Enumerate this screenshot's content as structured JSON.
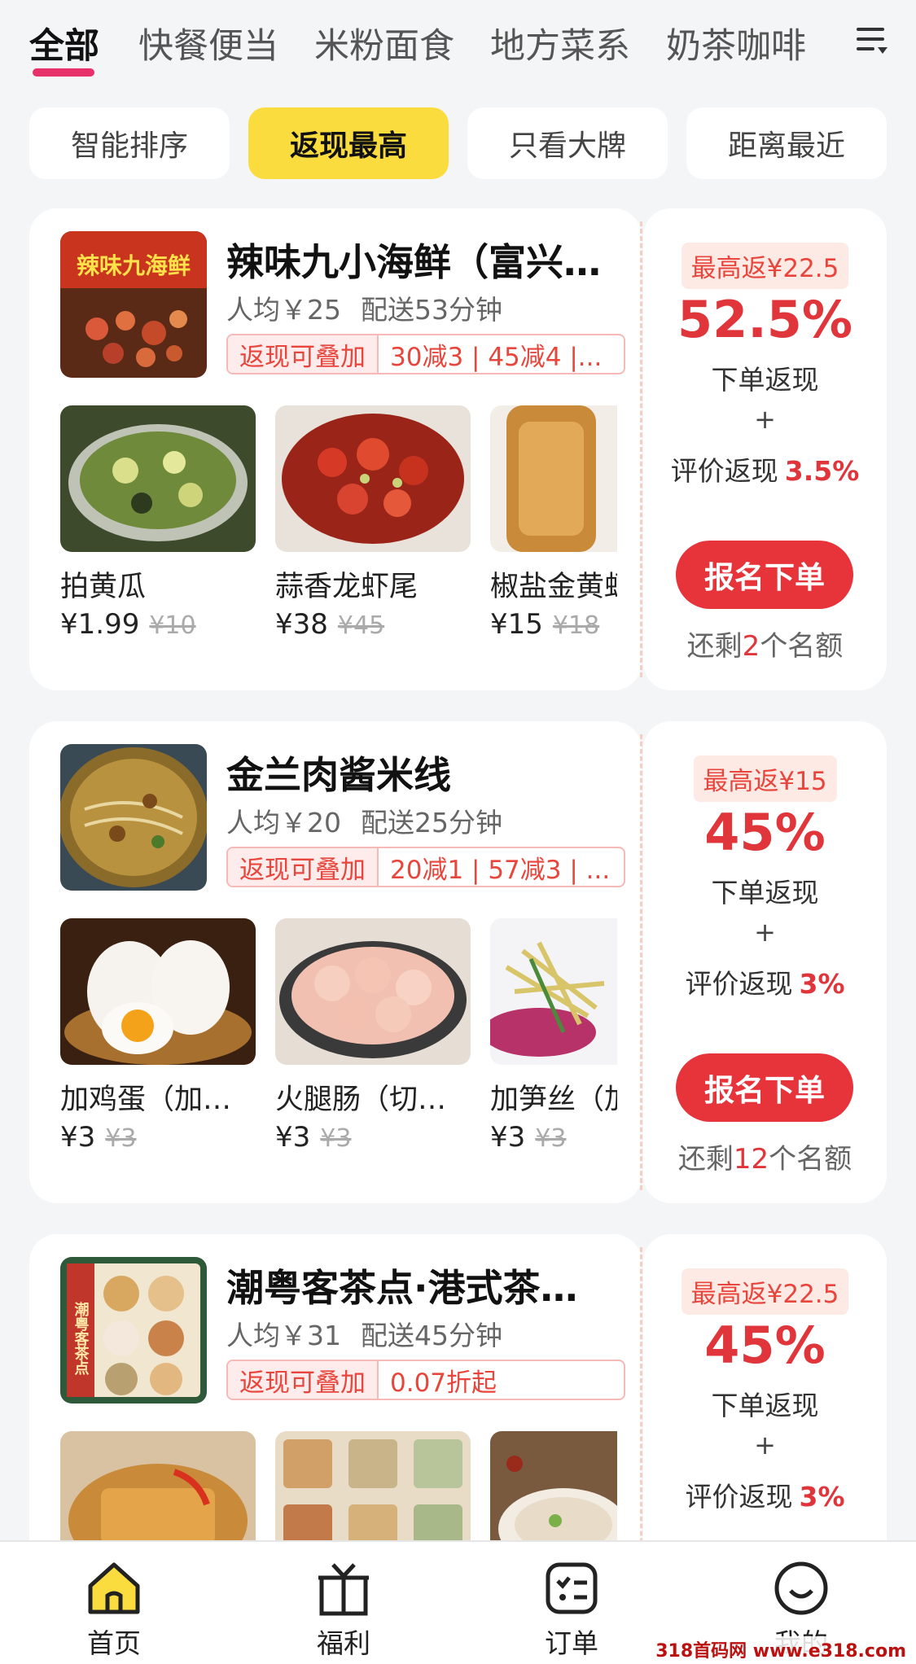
{
  "category_tabs": [
    {
      "label": "全部"
    },
    {
      "label": "快餐便当"
    },
    {
      "label": "米粉面食"
    },
    {
      "label": "地方菜系"
    },
    {
      "label": "奶茶咖啡"
    }
  ],
  "active_tab_index": 0,
  "menu_icon": "menu-icon",
  "sort_chips": [
    {
      "label": "智能排序"
    },
    {
      "label": "返现最高"
    },
    {
      "label": "只看大牌"
    },
    {
      "label": "距离最近"
    }
  ],
  "active_sort_index": 1,
  "colors": {
    "accent_red": "#e0363b",
    "active_chip": "#fbdc3f",
    "tab_underline": "#e8306a"
  },
  "stores": [
    {
      "name": "辣味九小海鲜（富兴…",
      "logo_text": "辣味九海鲜",
      "avg_price": "人均￥25",
      "delivery": "配送53分钟",
      "promo_tag": "返现可叠加",
      "promo_text": "30减3 | 45减4 |...",
      "dishes": [
        {
          "name": "拍黄瓜",
          "price": "¥1.99",
          "orig": "¥10"
        },
        {
          "name": "蒜香龙虾尾",
          "price": "¥38",
          "orig": "¥45"
        },
        {
          "name": "椒盐金黄虾",
          "price": "¥15",
          "orig": "¥18"
        }
      ],
      "max_return": "最高返¥22.5",
      "rate": "52.5%",
      "rate_label": "下单返现",
      "plus": "+",
      "review_label": "评价返现",
      "review_rate": "3.5%",
      "button": "报名下单",
      "quota_prefix": "还剩",
      "quota_count": "2",
      "quota_suffix": "个名额"
    },
    {
      "name": "金兰肉酱米线",
      "logo_text": "",
      "avg_price": "人均￥20",
      "delivery": "配送25分钟",
      "promo_tag": "返现可叠加",
      "promo_text": "20减1 | 57减3 | ...",
      "dishes": [
        {
          "name": "加鸡蛋（加…",
          "price": "¥3",
          "orig": "¥3"
        },
        {
          "name": "火腿肠（切…",
          "price": "¥3",
          "orig": "¥3"
        },
        {
          "name": "加笋丝（加",
          "price": "¥3",
          "orig": "¥3"
        }
      ],
      "max_return": "最高返¥15",
      "rate": "45%",
      "rate_label": "下单返现",
      "plus": "+",
      "review_label": "评价返现",
      "review_rate": "3%",
      "button": "报名下单",
      "quota_prefix": "还剩",
      "quota_count": "12",
      "quota_suffix": "个名额"
    },
    {
      "name": "潮粤客茶点·港式茶…",
      "logo_text": "潮粤客茶点",
      "avg_price": "人均￥31",
      "delivery": "配送45分钟",
      "promo_tag": "返现可叠加",
      "promo_text": "0.07折起",
      "dishes": [
        {
          "name": "",
          "price": "",
          "orig": ""
        },
        {
          "name": "",
          "price": "",
          "orig": ""
        },
        {
          "name": "",
          "price": "",
          "orig": ""
        }
      ],
      "max_return": "最高返¥22.5",
      "rate": "45%",
      "rate_label": "下单返现",
      "plus": "+",
      "review_label": "评价返现",
      "review_rate": "3%",
      "button": "",
      "quota_prefix": "",
      "quota_count": "",
      "quota_suffix": ""
    }
  ],
  "bottom_nav": [
    {
      "label": "首页",
      "icon": "home-icon",
      "active": true
    },
    {
      "label": "福利",
      "icon": "gift-icon",
      "active": false
    },
    {
      "label": "订单",
      "icon": "order-list-icon",
      "active": false
    },
    {
      "label": "我的",
      "icon": "smile-profile-icon",
      "active": false
    }
  ],
  "watermark": "318首码网 www.e318.com"
}
